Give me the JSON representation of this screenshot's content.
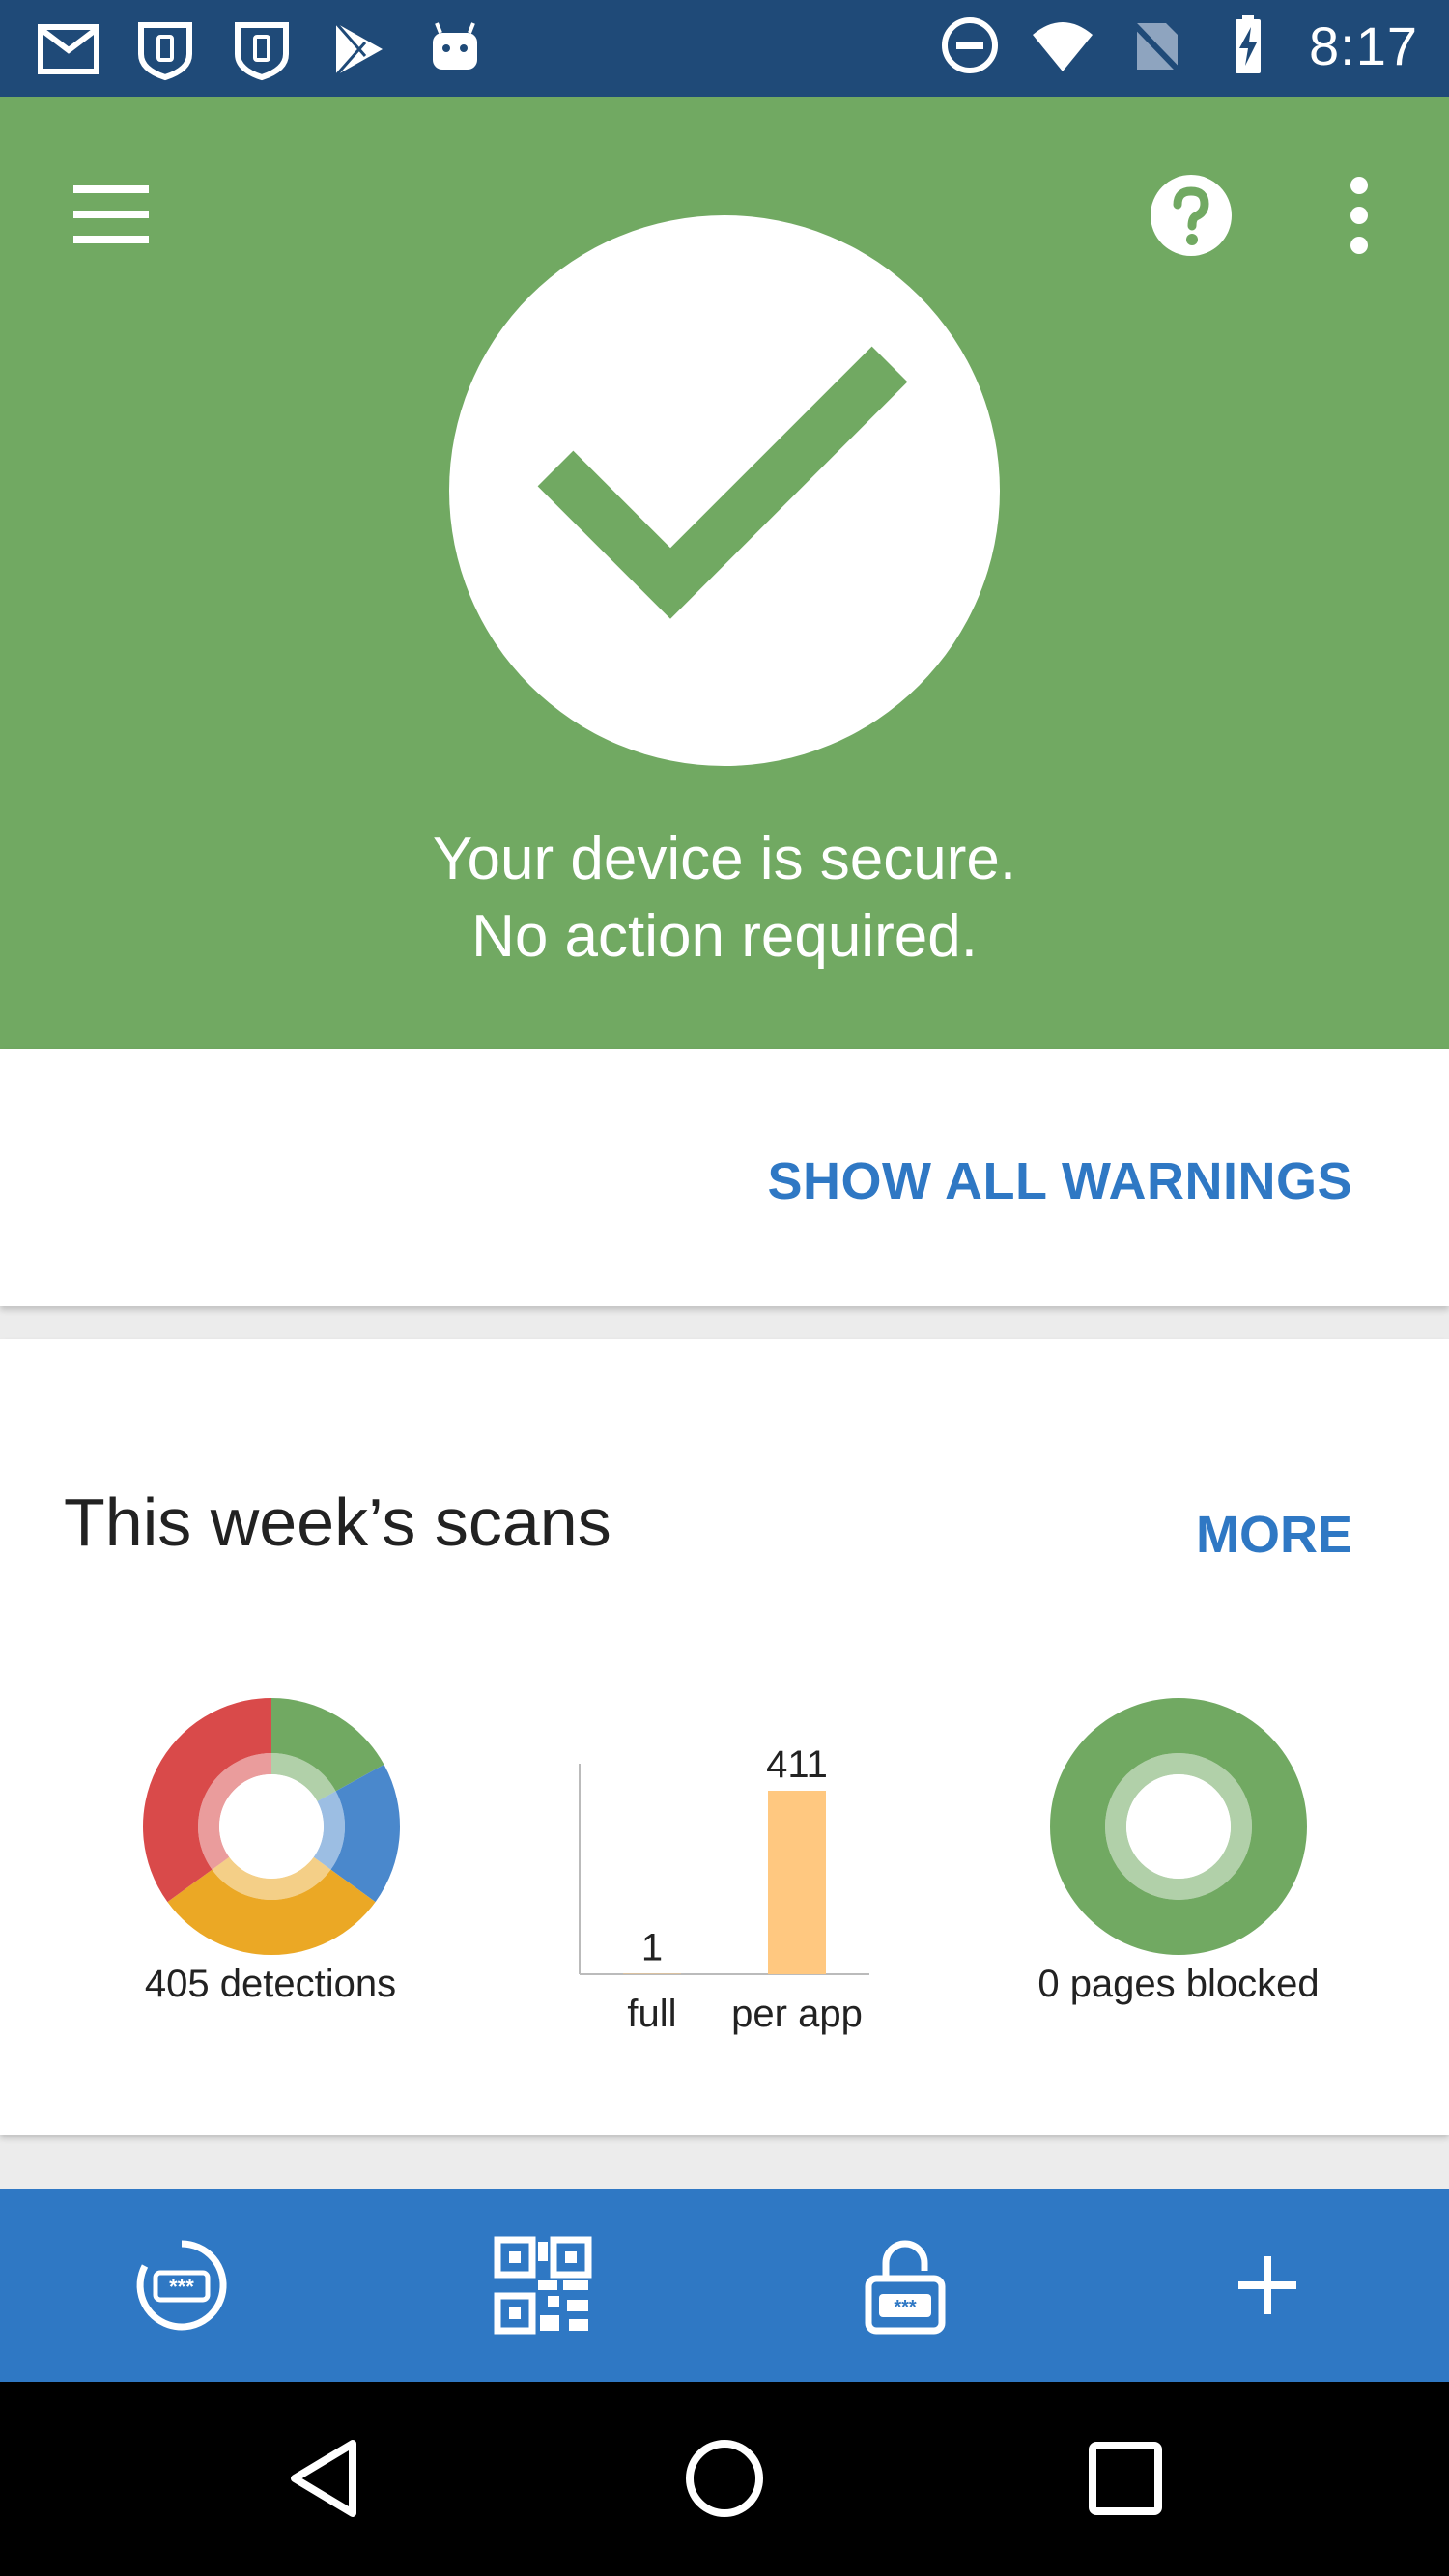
{
  "status_bar": {
    "time": "8:17",
    "left_icons": [
      "gmail-icon",
      "shield-icon",
      "shield-icon",
      "play-store-icon",
      "android-icon"
    ],
    "right_icons": [
      "do-not-disturb-icon",
      "wifi-icon",
      "no-sim-icon",
      "battery-charging-icon"
    ]
  },
  "hero": {
    "status_line1": "Your device is secure.",
    "status_line2": "No action required.",
    "icons": {
      "menu": "menu-icon",
      "help": "help-icon",
      "more": "more-vert-icon",
      "status": "checkmark-icon"
    },
    "color": "#71a962"
  },
  "warnings": {
    "show_all_label": "SHOW ALL WARNINGS"
  },
  "scans": {
    "title": "This week’s scans",
    "more_label": "MORE",
    "detections_label": "405 detections",
    "pages_blocked_label": "0 pages blocked"
  },
  "chart_data": [
    {
      "type": "pie",
      "title": "",
      "donut": true,
      "caption": "405 detections",
      "slices": [
        {
          "color": "#71a962",
          "share": 0.17
        },
        {
          "color": "#4a88cc",
          "share": 0.18
        },
        {
          "color": "#eba825",
          "share": 0.3
        },
        {
          "color": "#d94a4a",
          "share": 0.35
        }
      ]
    },
    {
      "type": "bar",
      "title": "",
      "categories": [
        "full",
        "per app"
      ],
      "values": [
        1,
        411
      ],
      "colors": [
        "#ffc880",
        "#ffc880"
      ],
      "ylim": [
        0,
        411
      ],
      "grid": false
    },
    {
      "type": "pie",
      "title": "",
      "donut": true,
      "caption": "0 pages blocked",
      "slices": [
        {
          "color": "#71a962",
          "share": 1.0
        }
      ]
    }
  ],
  "toolbar": {
    "items": [
      {
        "icon": "password-scan-icon"
      },
      {
        "icon": "qr-code-icon"
      },
      {
        "icon": "password-lock-icon"
      },
      {
        "icon": "add-icon"
      }
    ],
    "color": "#2f78c4"
  },
  "nav_bar": {
    "items": [
      {
        "icon": "back-icon"
      },
      {
        "icon": "home-icon"
      },
      {
        "icon": "recents-icon"
      }
    ]
  }
}
